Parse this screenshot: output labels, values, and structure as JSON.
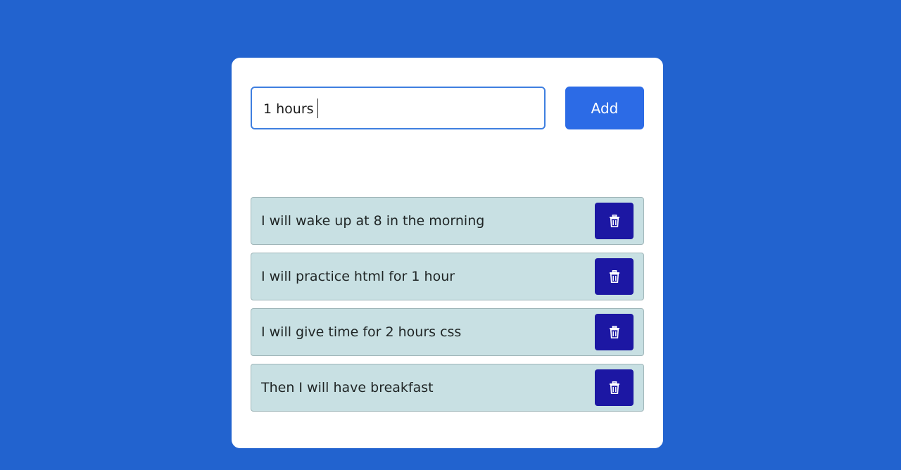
{
  "input": {
    "value": "1 hours",
    "placeholder": ""
  },
  "add_button": {
    "label": "Add"
  },
  "todos": [
    {
      "text": "I will wake up at 8 in the morning",
      "delete_icon": "trash-icon"
    },
    {
      "text": "I will practice html for 1 hour",
      "delete_icon": "trash-icon"
    },
    {
      "text": "I will give time for 2 hours css",
      "delete_icon": "trash-icon"
    },
    {
      "text": "Then I will have breakfast",
      "delete_icon": "trash-icon"
    }
  ],
  "colors": {
    "background": "#2263cf",
    "card": "#ffffff",
    "add_button": "#2c6be6",
    "todo_item": "#c8e0e3",
    "delete_button": "#1c17a3"
  }
}
